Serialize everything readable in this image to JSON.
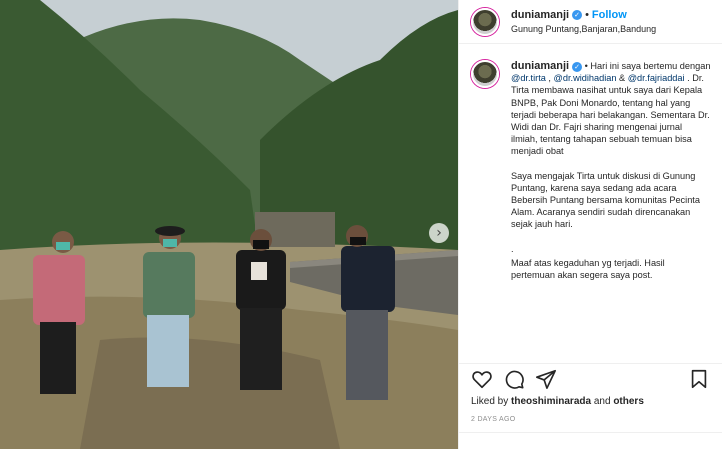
{
  "post": {
    "username": "duniamanji",
    "verified_badge": "✓",
    "separator": "•",
    "follow_label": "Follow",
    "location": "Gunung Puntang,Banjaran,Bandung"
  },
  "caption": {
    "username": "duniamanji",
    "separator": "•",
    "line1_a": "Hari ini saya bertemu dengan ",
    "mention1": "@dr.tirta",
    "line1_b": " , ",
    "mention2": "@dr.widihadian",
    "line1_c": " & ",
    "mention3": "@dr.fajriaddai",
    "line1_d": " . Dr. Tirta membawa nasihat untuk saya dari Kepala BNPB, Pak Doni Monardo, tentang hal yang terjadi beberapa hari belakangan. Sementara Dr. Widi dan Dr. Fajri sharing mengenai jurnal ilmiah, tentang tahapan sebuah temuan bisa menjadi obat",
    "paragraph2": "Saya mengajak Tirta untuk diskusi di Gunung Puntang, karena saya sedang ada acara Bebersih Puntang bersama komunitas Pecinta Alam. Acaranya sendiri sudah direncanakan sejak jauh hari.",
    "paragraph3": ".",
    "paragraph4": "Maaf atas kegaduhan yg terjadi. Hasil pertemuan akan segera saya post."
  },
  "actions": {
    "like_icon": "heart-icon",
    "comment_icon": "comment-icon",
    "share_icon": "send-icon",
    "save_icon": "bookmark-icon"
  },
  "likes": {
    "prefix": "Liked by ",
    "user": "theoshiminarada",
    "suffix": " and ",
    "others": "others"
  },
  "date": "2 DAYS AGO",
  "carousel": {
    "next_glyph": "›"
  }
}
